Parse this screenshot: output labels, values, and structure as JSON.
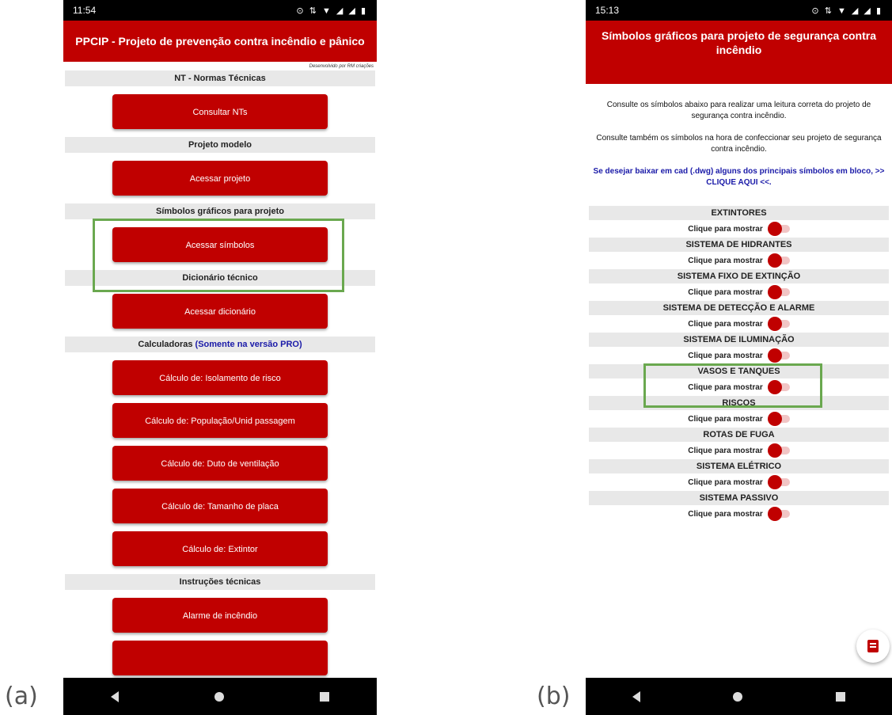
{
  "labels": {
    "a": "(a)",
    "b": "(b)"
  },
  "phone_a": {
    "status": {
      "time": "11:54",
      "icons": "⊙ ⇅ ▼ ◢ ◢ ▮"
    },
    "app_title": "PPCIP - Projeto de prevenção contra incêndio e pânico",
    "credit": "Desenvolvido por RM criações",
    "sections": [
      {
        "header": "NT - Normas Técnicas",
        "buttons": [
          "Consultar NTs"
        ]
      },
      {
        "header": "Projeto modelo",
        "buttons": [
          "Acessar projeto"
        ]
      },
      {
        "header": "Símbolos gráficos para projeto",
        "buttons": [
          "Acessar símbolos"
        ]
      },
      {
        "header": "Dicionário técnico",
        "buttons": [
          "Acessar dicionário"
        ]
      },
      {
        "header": "Calculadoras",
        "header_extra": "(Somente na versão PRO)",
        "buttons": [
          "Cálculo de: Isolamento de risco",
          "Cálculo de: População/Unid passagem",
          "Cálculo de: Duto de ventilação",
          "Cálculo de: Tamanho de placa",
          "Cálculo de: Extintor"
        ]
      },
      {
        "header": "Instruções técnicas",
        "buttons": [
          "Alarme de incêndio"
        ]
      }
    ]
  },
  "phone_b": {
    "status": {
      "time": "15:13",
      "icons": "⊙ ⇅ ▼ ◢ ◢ ▮"
    },
    "app_title": "Símbolos gráficos para projeto de segurança contra incêndio",
    "para1": "Consulte os símbolos abaixo para realizar uma leitura correta do projeto de segurança contra incêndio.",
    "para2": "Consulte também os símbolos na hora de confeccionar seu projeto de segurança contra incêndio.",
    "link": "Se desejar baixar em cad (.dwg) alguns dos principais símbolos em bloco, >> CLIQUE AQUI <<.",
    "toggle_label": "Clique para mostrar",
    "categories": [
      "EXTINTORES",
      "SISTEMA DE HIDRANTES",
      "SISTEMA FIXO DE EXTINÇÃO",
      "SISTEMA DE DETECÇÃO E ALARME",
      "SISTEMA DE ILUMINAÇÃO",
      "VASOS E TANQUES",
      "RISCOS",
      "ROTAS DE FUGA",
      "SISTEMA ELÉTRICO",
      "SISTEMA PASSIVO"
    ]
  },
  "colors": {
    "primary": "#c00000",
    "highlight": "#6aa84f",
    "link": "#1a1aa8"
  }
}
